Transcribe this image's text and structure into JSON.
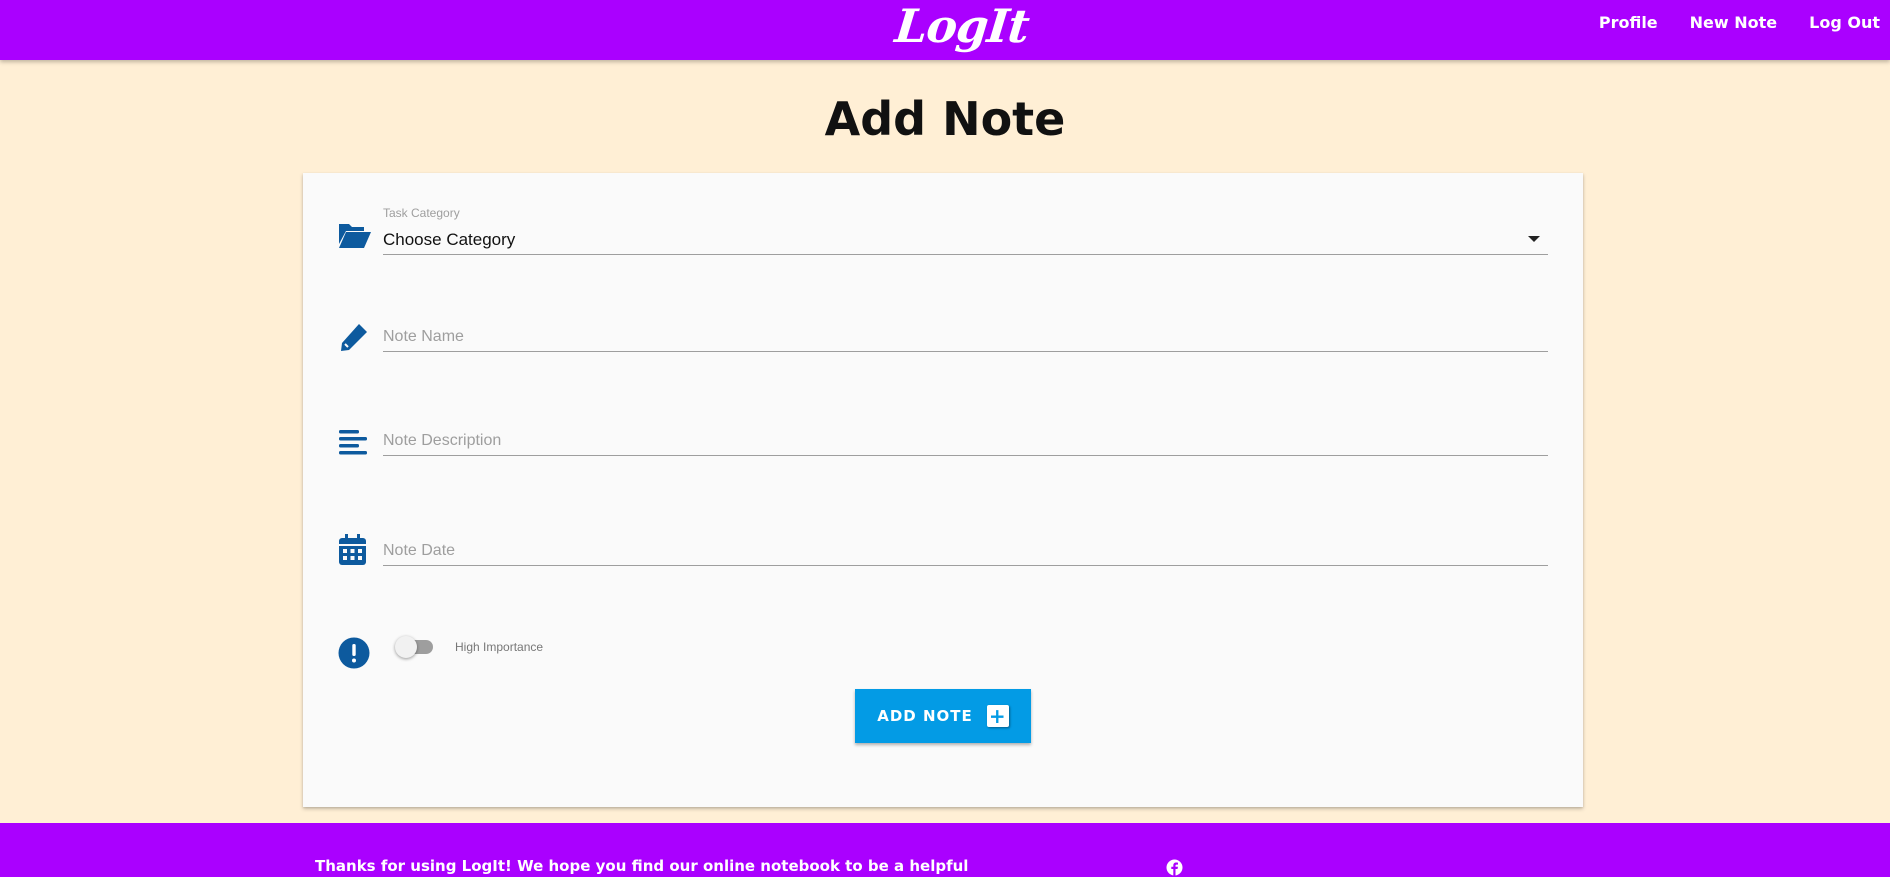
{
  "navbar": {
    "brand": "LogIt",
    "links": [
      "Profile",
      "New Note",
      "Log Out"
    ]
  },
  "page": {
    "title": "Add Note"
  },
  "form": {
    "category": {
      "label": "Task Category",
      "value": "Choose Category",
      "icon": "folder-open-icon"
    },
    "note_name": {
      "placeholder": "Note Name",
      "icon": "pencil-icon"
    },
    "note_description": {
      "placeholder": "Note Description",
      "icon": "align-left-icon"
    },
    "note_date": {
      "placeholder": "Note Date",
      "icon": "calendar-icon"
    },
    "importance": {
      "label": "High Importance",
      "checked": false,
      "icon": "exclamation-circle-icon"
    },
    "submit_label": "ADD NOTE"
  },
  "footer": {
    "text": "Thanks for using LogIt! We hope you find our online notebook to be a helpful",
    "icon": "facebook-icon"
  },
  "colors": {
    "primary": "#aa00ff",
    "background": "#ffefd5",
    "icon_blue": "#0d5a9e",
    "button_blue": "#039be5"
  }
}
